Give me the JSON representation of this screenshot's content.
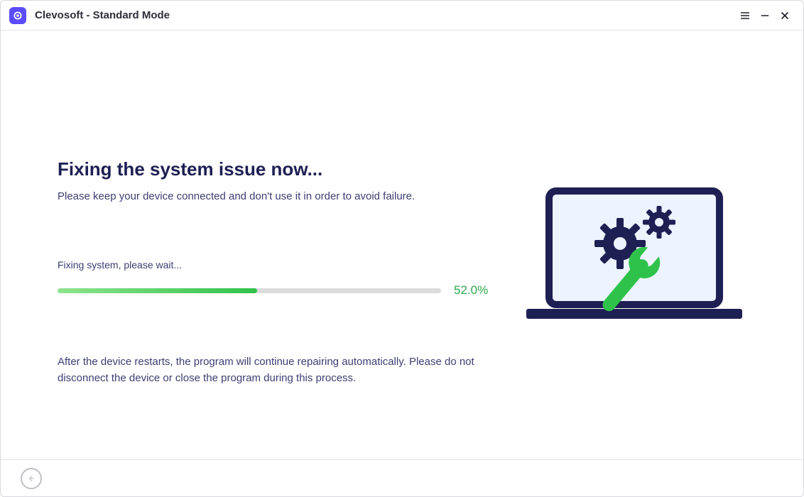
{
  "titlebar": {
    "title": "Clevosoft - Standard Mode"
  },
  "main": {
    "heading": "Fixing the system issue now...",
    "subtext": "Please keep your device connected and don't use it in order to avoid failure.",
    "status_label": "Fixing system, please wait...",
    "progress_percent": 52.0,
    "progress_display": "52.0%",
    "note": "After the device restarts, the program will continue repairing automatically. Please do not disconnect the device or close the program during this process."
  },
  "colors": {
    "accent": "#5b4cff",
    "heading": "#1e1f53",
    "progress_start": "#8fe38f",
    "progress_end": "#2fc24a",
    "progress_text": "#2ea84a",
    "illust_dark": "#1e1f53",
    "illust_green": "#2fc24a"
  }
}
